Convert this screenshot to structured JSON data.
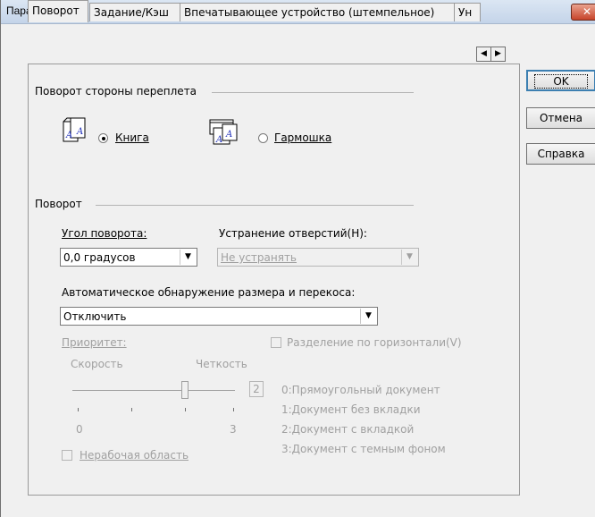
{
  "window": {
    "title": "Параметр",
    "close_label": "✕"
  },
  "tabs": [
    {
      "label": "Поворот"
    },
    {
      "label": "Задание/Кэш"
    },
    {
      "label": "Впечатывающее устройство (штемпельное)"
    },
    {
      "label": "Ун"
    }
  ],
  "binding": {
    "group_title": "Поворот стороны переплета",
    "option_book": "Книга",
    "option_fan": "Гармошка",
    "selected": "Книга"
  },
  "rotation": {
    "group_title": "Поворот",
    "angle_label": "Угол поворота:",
    "angle_value": "0,0 градусов",
    "holes_label": "Устранение  отверстий(Н):",
    "holes_value": "Не устранять",
    "auto_label": "Автоматическое обнаружение размера и перекоса:",
    "auto_value": "Отключить",
    "priority_label": "Приоритет:",
    "split_label": "Разделение по горизонтали(V)",
    "speed_label": "Скорость",
    "clarity_label": "Четкость",
    "slider_value": "2",
    "tick_min": "0",
    "tick_max": "3",
    "slider_level": 2,
    "legend": [
      "0:Прямоугольный документ",
      "1:Документ без вкладки",
      "2:Документ с вкладкой",
      "3:Документ с темным фоном"
    ],
    "nonwork_label": "Нерабочая область"
  },
  "buttons": {
    "ok": "OK",
    "cancel": "Отмена",
    "help": "Справка"
  }
}
